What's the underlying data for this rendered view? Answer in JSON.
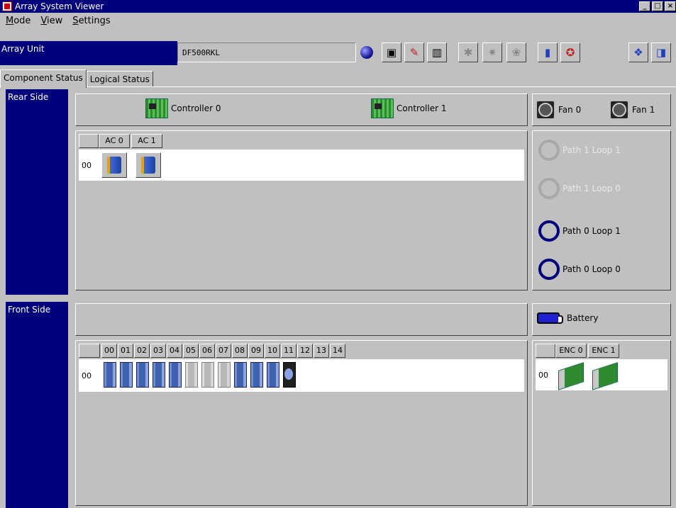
{
  "window": {
    "title": "Array System Viewer"
  },
  "menu": [
    "Mode",
    "View",
    "Settings"
  ],
  "unit": {
    "label": "Array Unit",
    "value": "DF500RKL"
  },
  "tabs": [
    "Component Status",
    "Logical Status"
  ],
  "rear": {
    "label": "Rear Side",
    "controllers": [
      "Controller 0",
      "Controller 1"
    ],
    "fans": [
      "Fan 0",
      "Fan 1"
    ],
    "ac_headers": [
      "AC 0",
      "AC 1"
    ],
    "row_label": "00",
    "paths": [
      {
        "label": "Path 1  Loop 1",
        "state": "inactive"
      },
      {
        "label": "Path 1  Loop 0",
        "state": "inactive"
      },
      {
        "label": "Path 0  Loop 1",
        "state": "active"
      },
      {
        "label": "Path 0  Loop 0",
        "state": "active"
      }
    ]
  },
  "front": {
    "label": "Front Side",
    "battery": "Battery",
    "drive_headers": [
      "00",
      "01",
      "02",
      "03",
      "04",
      "05",
      "06",
      "07",
      "08",
      "09",
      "10",
      "11",
      "12",
      "13",
      "14"
    ],
    "row_label": "00",
    "drives": [
      "installed",
      "installed",
      "installed",
      "installed",
      "installed",
      "empty",
      "empty",
      "empty",
      "installed",
      "installed",
      "installed",
      "spare"
    ],
    "enc_headers": [
      "ENC 0",
      "ENC 1"
    ],
    "enc_row_label": "00"
  },
  "colors": {
    "accent_blue": "#00007b",
    "face": "#c0c0c0"
  }
}
